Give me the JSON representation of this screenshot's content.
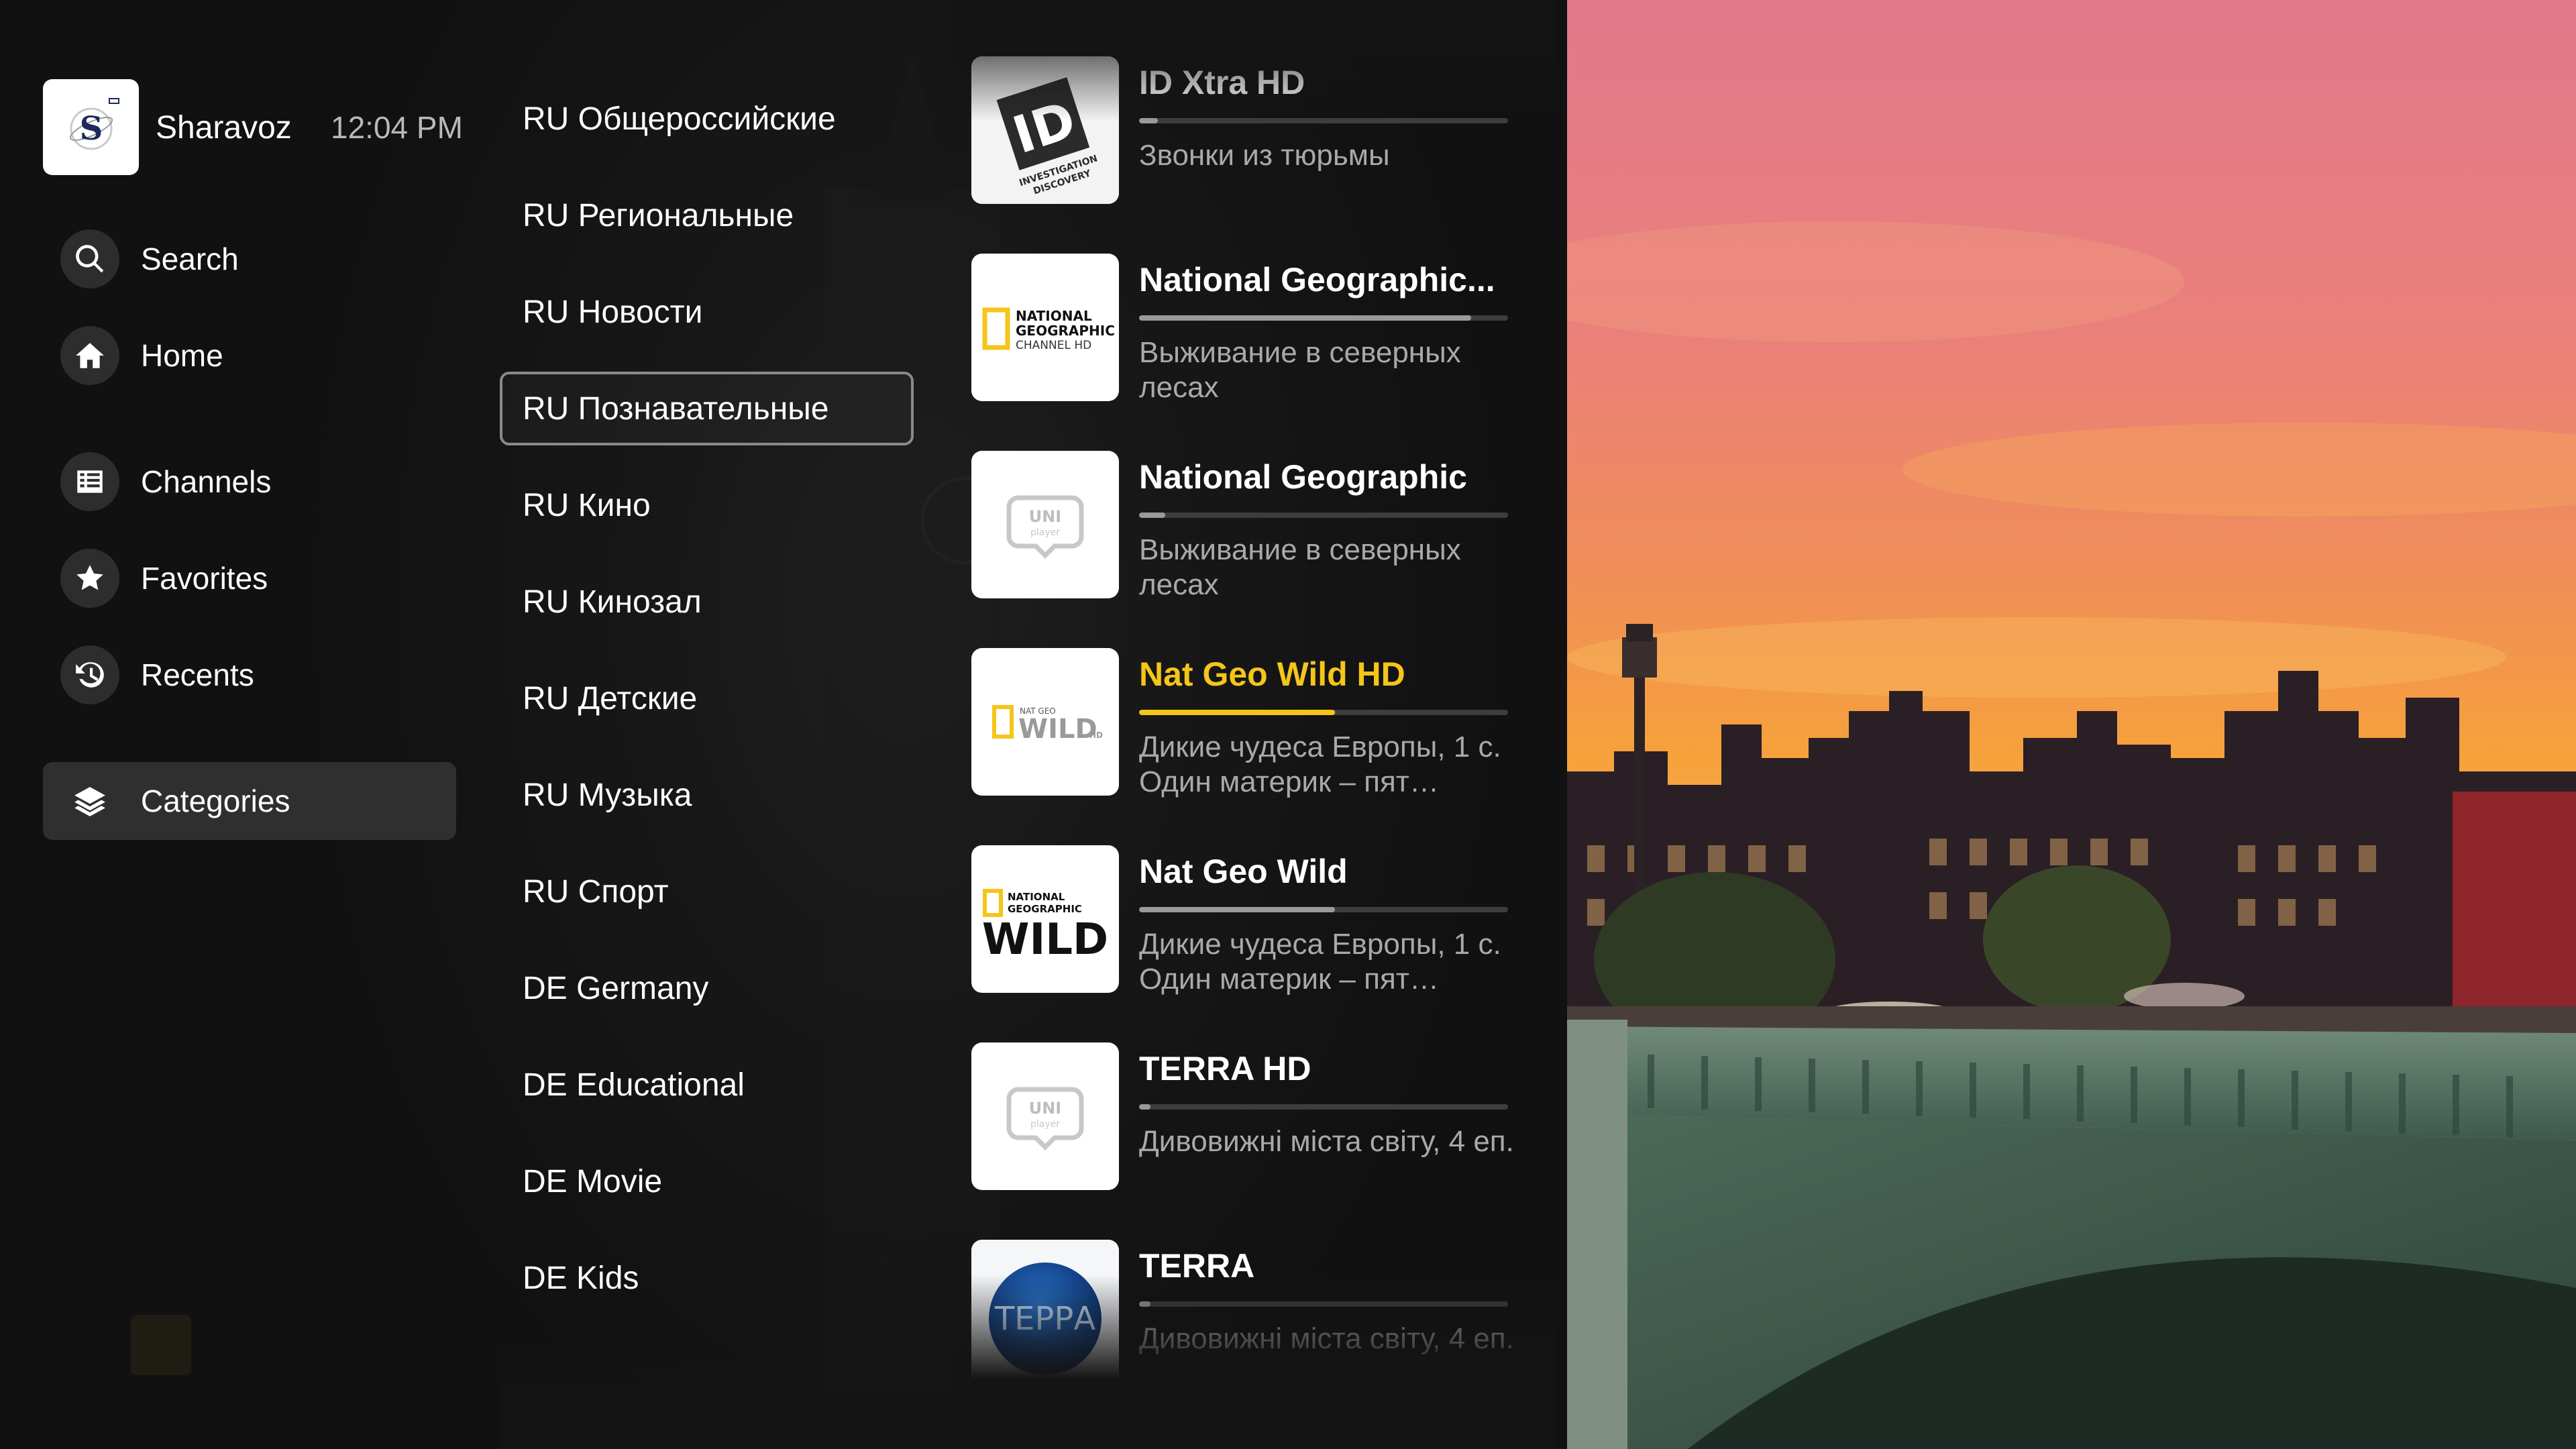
{
  "app": {
    "name": "Sharavoz",
    "time": "12:04 PM"
  },
  "nav": [
    {
      "label": "Search",
      "icon": "search-icon"
    },
    {
      "label": "Home",
      "icon": "home-icon"
    },
    {
      "label": "Channels",
      "icon": "channels-icon"
    },
    {
      "label": "Favorites",
      "icon": "star-icon"
    },
    {
      "label": "Recents",
      "icon": "history-icon"
    },
    {
      "label": "Categories",
      "icon": "layers-icon",
      "active": true
    }
  ],
  "categories": [
    "RU Общероссийские",
    "RU Региональные",
    "RU Новости",
    "RU Познавательные",
    "RU Кино",
    "RU Кинозал",
    "RU Детские",
    "RU Музыка",
    "RU Спорт",
    "DE Germany",
    "DE Educational",
    "DE Movie",
    "DE Kids"
  ],
  "selected_category": "RU Познавательные",
  "channels": [
    {
      "name": "ID Xtra HD",
      "program": "Звонки из тюрьмы",
      "progress": 0.05,
      "logo": "id-logo",
      "highlight": false
    },
    {
      "name": "National Geographic...",
      "program": "Выживание в северных лесах",
      "progress": 0.9,
      "logo": "natgeo-channel-logo",
      "logo_text": [
        "NATIONAL",
        "GEOGRAPHIC",
        "CHANNEL HD"
      ],
      "highlight": false
    },
    {
      "name": "National Geographic",
      "program": "Выживание в северных лесах",
      "progress": 0.07,
      "logo": "uniplayer-logo",
      "logo_text": [
        "UNI",
        "player"
      ],
      "highlight": false
    },
    {
      "name": "Nat Geo Wild HD",
      "program": "Дикие чудеса Европы, 1 с. Один материк – пят…",
      "progress": 0.53,
      "logo": "natgeo-wild-hd-logo",
      "logo_text": [
        "NAT GEO",
        "WILD",
        "HD"
      ],
      "highlight": true
    },
    {
      "name": "Nat Geo Wild",
      "program": "Дикие чудеса Европы, 1 с. Один материк – пят…",
      "progress": 0.53,
      "logo": "natgeo-wild-logo",
      "logo_text": [
        "NATIONAL",
        "GEOGRAPHIC",
        "WILD"
      ],
      "highlight": false
    },
    {
      "name": "TERRA HD",
      "program": "Дивовижні міста світу, 4 еп.",
      "progress": 0.03,
      "logo": "uniplayer-logo",
      "logo_text": [
        "UNI",
        "player"
      ],
      "highlight": false
    },
    {
      "name": "TERRA",
      "program": "Дивовижні міста світу, 4 еп.",
      "progress": 0.03,
      "logo": "terra-logo",
      "logo_text": [
        "ТЕРРА"
      ],
      "highlight": false
    }
  ],
  "colors": {
    "accent": "#f5c518",
    "background": "#141414"
  }
}
